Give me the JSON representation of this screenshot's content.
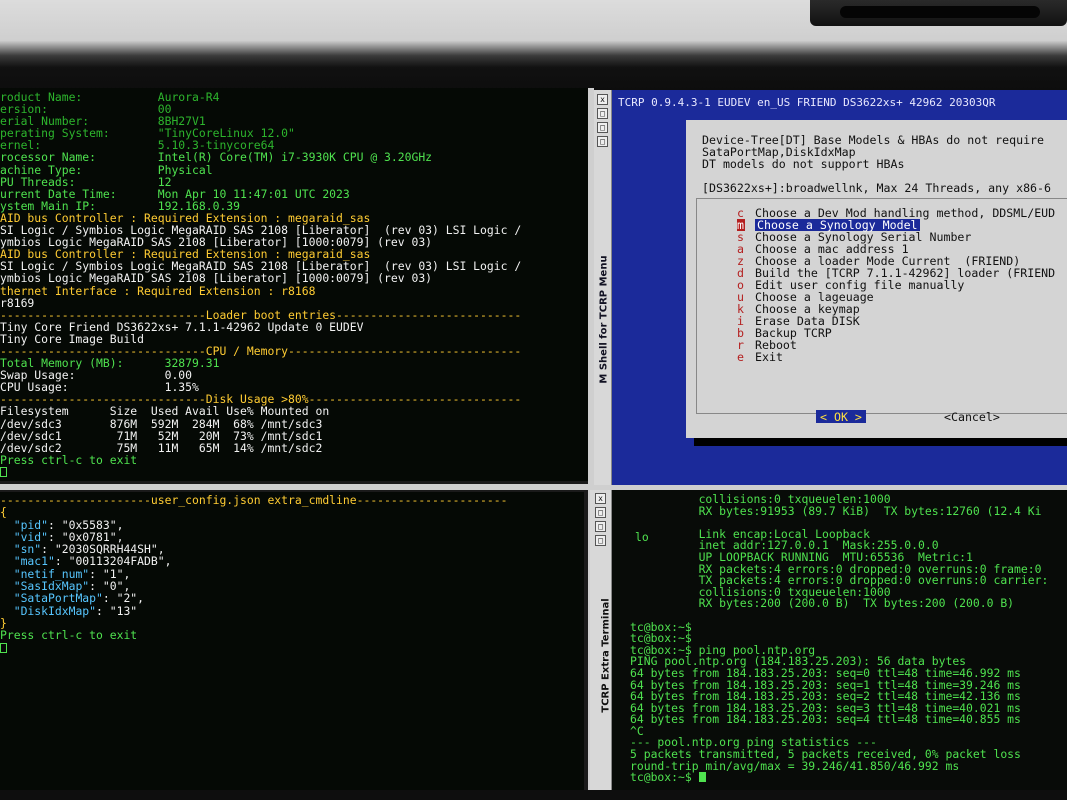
{
  "top_left_terminal": {
    "lines": [
      {
        "t": "roduct Name:           Aurora-R4",
        "c": "gd"
      },
      {
        "t": "ersion:                00",
        "c": "gd"
      },
      {
        "t": "erial Number:          8BH27V1",
        "c": "gd"
      },
      {
        "t": "perating System:       \"TinyCoreLinux 12.0\"",
        "c": "gd"
      },
      {
        "t": "ernel:                 5.10.3-tinycore64",
        "c": "gd"
      },
      {
        "t": "rocessor Name:         Intel(R) Core(TM) i7-3930K CPU @ 3.20GHz",
        "c": "g"
      },
      {
        "t": "achine Type:           Physical",
        "c": "g"
      },
      {
        "t": "PU Threads:            12",
        "c": "g"
      },
      {
        "t": "urrent Date Time:      Mon Apr 10 11:47:01 UTC 2023",
        "c": "g"
      },
      {
        "t": "ystem Main IP:         192.168.0.39",
        "c": "g"
      },
      {
        "t": "AID bus Controller : Required Extension : megaraid_sas",
        "c": "yl"
      },
      {
        "t": "SI Logic / Symbios Logic MegaRAID SAS 2108 [Liberator]  (rev 03) LSI Logic /",
        "c": "wh"
      },
      {
        "t": "ymbios Logic MegaRAID SAS 2108 [Liberator] [1000:0079] (rev 03)",
        "c": "wh"
      },
      {
        "t": "AID bus Controller : Required Extension : megaraid_sas",
        "c": "yl"
      },
      {
        "t": "SI Logic / Symbios Logic MegaRAID SAS 2108 [Liberator]  (rev 03) LSI Logic /",
        "c": "wh"
      },
      {
        "t": "ymbios Logic MegaRAID SAS 2108 [Liberator] [1000:0079] (rev 03)",
        "c": "wh"
      },
      {
        "t": "thernet Interface : Required Extension : r8168",
        "c": "yl"
      },
      {
        "t": "r8169",
        "c": "wh"
      },
      {
        "t": "------------------------------Loader boot entries---------------------------",
        "c": "yl"
      },
      {
        "t": "Tiny Core Friend DS3622xs+ 7.1.1-42962 Update 0 EUDEV",
        "c": "wh"
      },
      {
        "t": "Tiny Core Image Build",
        "c": "wh"
      },
      {
        "t": "------------------------------CPU / Memory----------------------------------",
        "c": "yl"
      },
      {
        "t": "Total Memory (MB):      32879.31",
        "c": "g"
      },
      {
        "t": "Swap Usage:             0.00",
        "c": "wh"
      },
      {
        "t": "CPU Usage:              1.35%",
        "c": "wh"
      },
      {
        "t": "------------------------------Disk Usage >80%-------------------------------",
        "c": "yl"
      },
      {
        "t": "Filesystem      Size  Used Avail Use% Mounted on",
        "c": "wh"
      },
      {
        "t": "/dev/sdc3       876M  592M  284M  68% /mnt/sdc3",
        "c": "wh"
      },
      {
        "t": "/dev/sdc1        71M   52M   20M  73% /mnt/sdc1",
        "c": "wh"
      },
      {
        "t": "/dev/sdc2        75M   11M   65M  14% /mnt/sdc2",
        "c": "wh"
      },
      {
        "t": "Press ctrl-c to exit",
        "c": "g"
      }
    ]
  },
  "tcrp_menu": {
    "sidebar_title": "M Shell for TCRP Menu",
    "sidebar_buttons": [
      "x",
      "□",
      "□",
      "□"
    ],
    "header": "TCRP 0.9.4.3-1 EUDEV en_US FRIEND DS3622xs+ 42962 20303QR",
    "info_lines": [
      "Device-Tree[DT] Base Models & HBAs do not require",
      "SataPortMap,DiskIdxMap",
      "DT models do not support HBAs"
    ],
    "model_line": "[DS3622xs+]:broadwellnk, Max 24 Threads, any x86-6",
    "items": [
      {
        "key": "c",
        "label": "Choose a Dev Mod handling method, DDSML/EUD"
      },
      {
        "key": "m",
        "label": "Choose a Synology Model",
        "selected": true
      },
      {
        "key": "s",
        "label": "Choose a Synology Serial Number"
      },
      {
        "key": "a",
        "label": "Choose a mac address 1"
      },
      {
        "key": "z",
        "label": "Choose a loader Mode Current  (FRIEND)"
      },
      {
        "key": "d",
        "label": "Build the [TCRP 7.1.1-42962] loader (FRIEND"
      },
      {
        "key": "o",
        "label": "Edit user config file manually"
      },
      {
        "key": "u",
        "label": "Choose a lageuage"
      },
      {
        "key": "k",
        "label": "Choose a keymap"
      },
      {
        "key": "i",
        "label": "Erase Data DISK"
      },
      {
        "key": "b",
        "label": "Backup TCRP"
      },
      {
        "key": "r",
        "label": "Reboot"
      },
      {
        "key": "e",
        "label": "Exit"
      }
    ],
    "ok_label": "< OK >",
    "cancel_label": "<Cancel>"
  },
  "config_terminal": {
    "header": "----------------------user_config.json extra_cmdline----------------------",
    "open_brace": "{",
    "entries": [
      {
        "key": "\"pid\"",
        "value": "\"0x5583\","
      },
      {
        "key": "\"vid\"",
        "value": "\"0x0781\","
      },
      {
        "key": "\"sn\"",
        "value": "\"2030SQRRH44SH\","
      },
      {
        "key": "\"mac1\"",
        "value": "\"00113204FADB\","
      },
      {
        "key": "\"netif_num\"",
        "value": "\"1\","
      },
      {
        "key": "\"SasIdxMap\"",
        "value": "\"0\","
      },
      {
        "key": "\"SataPortMap\"",
        "value": "\"2\","
      },
      {
        "key": "\"DiskIdxMap\"",
        "value": "\"13\""
      }
    ],
    "close_brace": "}",
    "footer": "Press ctrl-c to exit"
  },
  "extra_terminal": {
    "sidebar_title": "TCRP Extra Terminal",
    "sidebar_buttons": [
      "x",
      "□",
      "□",
      "□"
    ],
    "lo_label": "lo",
    "lines": [
      "          collisions:0 txqueuelen:1000",
      "          RX bytes:91953 (89.7 KiB)  TX bytes:12760 (12.4 Ki",
      "",
      "          Link encap:Local Loopback",
      "          inet addr:127.0.0.1  Mask:255.0.0.0",
      "          UP LOOPBACK RUNNING  MTU:65536  Metric:1",
      "          RX packets:4 errors:0 dropped:0 overruns:0 frame:0",
      "          TX packets:4 errors:0 dropped:0 overruns:0 carrier:",
      "          collisions:0 txqueuelen:1000",
      "          RX bytes:200 (200.0 B)  TX bytes:200 (200.0 B)",
      "",
      "tc@box:~$",
      "tc@box:~$",
      "tc@box:~$ ping pool.ntp.org",
      "PING pool.ntp.org (184.183.25.203): 56 data bytes",
      "64 bytes from 184.183.25.203: seq=0 ttl=48 time=46.992 ms",
      "64 bytes from 184.183.25.203: seq=1 ttl=48 time=39.246 ms",
      "64 bytes from 184.183.25.203: seq=2 ttl=48 time=42.136 ms",
      "64 bytes from 184.183.25.203: seq=3 ttl=48 time=40.021 ms",
      "64 bytes from 184.183.25.203: seq=4 ttl=48 time=40.855 ms",
      "^C",
      "--- pool.ntp.org ping statistics ---",
      "5 packets transmitted, 5 packets received, 0% packet loss",
      "round-trip min/avg/max = 39.246/41.850/46.992 ms"
    ],
    "prompt": "tc@box:~$ "
  }
}
